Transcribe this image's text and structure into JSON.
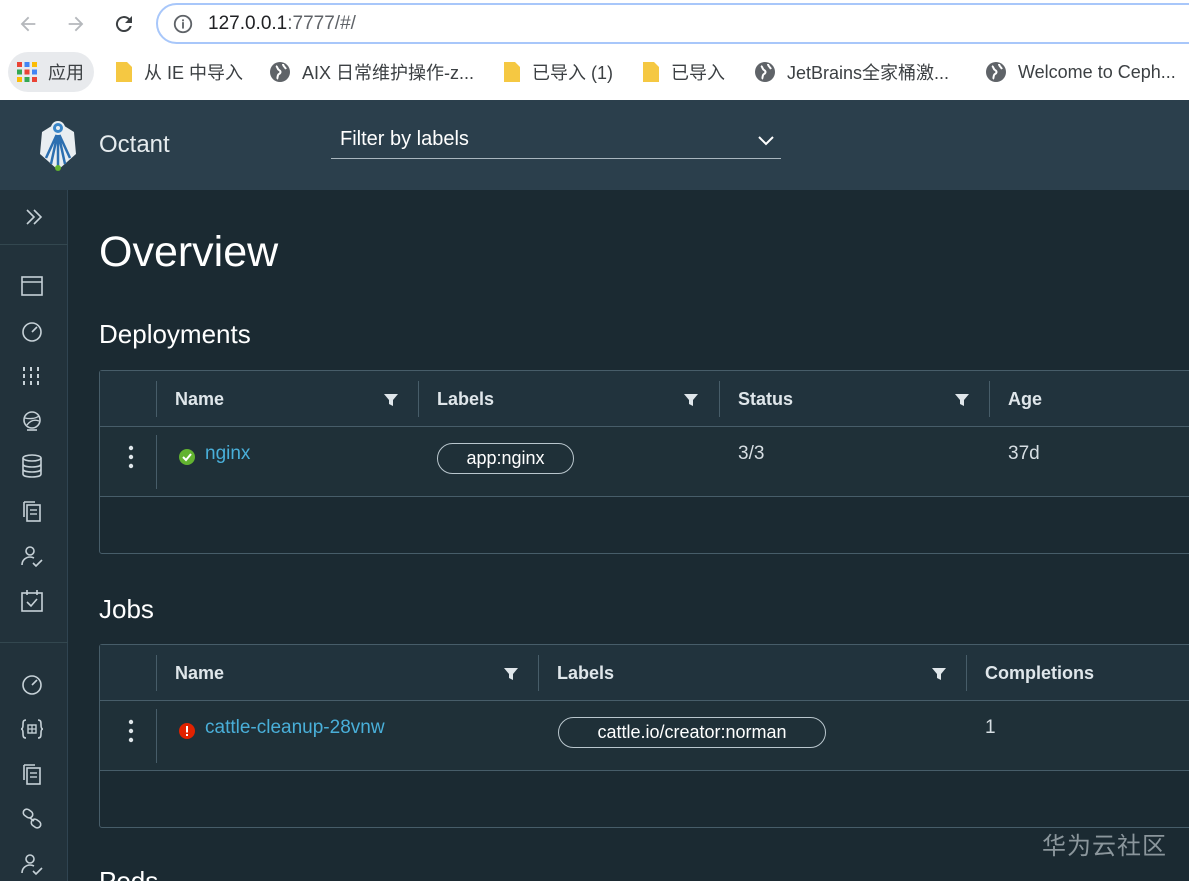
{
  "browser": {
    "url_host": "127.0.0.1",
    "url_rest": ":7777/#/",
    "bookmarks": [
      "应用",
      "从 IE 中导入",
      "AIX 日常维护操作-z...",
      "已导入 (1)",
      "已导入",
      "JetBrains全家桶激...",
      "Welcome to Ceph..."
    ]
  },
  "header": {
    "app_name": "Octant",
    "filter_placeholder": "Filter by labels"
  },
  "page": {
    "title": "Overview"
  },
  "deployments": {
    "title": "Deployments",
    "columns": [
      "Name",
      "Labels",
      "Status",
      "Age"
    ],
    "rows": [
      {
        "name": "nginx",
        "label": "app:nginx",
        "status": "3/3",
        "age": "37d",
        "state": "ok"
      }
    ]
  },
  "jobs": {
    "title": "Jobs",
    "columns": [
      "Name",
      "Labels",
      "Completions"
    ],
    "rows": [
      {
        "name": "cattle-cleanup-28vnw",
        "label": "cattle.io/creator:norman",
        "completions": "1",
        "state": "error"
      }
    ]
  },
  "pods": {
    "title": "Pods"
  },
  "watermark": "华为云社区",
  "colors": {
    "header_bg": "#2b3f4c",
    "content_bg": "#1b2a32",
    "link": "#49afd9",
    "ok": "#62b330",
    "error": "#e12200"
  }
}
